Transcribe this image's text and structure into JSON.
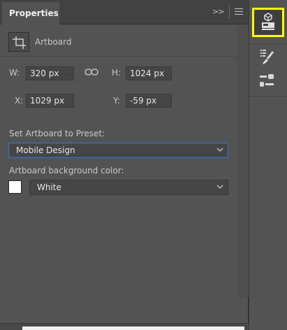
{
  "panel": {
    "tab_label": "Properties",
    "collapse_label": ">>",
    "section_title": "Artboard"
  },
  "dimensions": {
    "w_label": "W:",
    "w_value": "320 px",
    "h_label": "H:",
    "h_value": "1024 px",
    "x_label": "X:",
    "x_value": "1029 px",
    "y_label": "Y:",
    "y_value": "-59 px"
  },
  "preset": {
    "label": "Set Artboard to Preset:",
    "selected": "Mobile Design"
  },
  "background": {
    "label": "Artboard background color:",
    "selected": "White",
    "swatch_color": "#ffffff"
  },
  "rail": {
    "icons": [
      "3d-properties-icon",
      "brush-settings-icon",
      "adjustments-icon"
    ],
    "highlight_color": "#ffff00"
  }
}
